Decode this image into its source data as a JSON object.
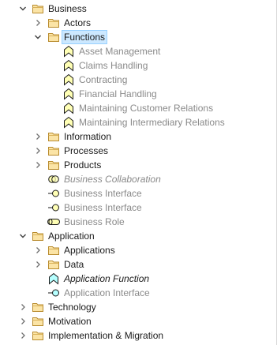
{
  "tree": {
    "business": {
      "label": "Business",
      "actors": "Actors",
      "functions": {
        "label": "Functions",
        "children": [
          "Asset Management",
          "Claims Handling",
          "Contracting",
          "Financial Handling",
          "Maintaining Customer Relations",
          "Maintaining Intermediary Relations"
        ]
      },
      "information": "Information",
      "processes": "Processes",
      "products": "Products",
      "business_collaboration": "Business Collaboration",
      "business_interface_1": "Business Interface",
      "business_interface_2": "Business Interface",
      "business_role": "Business Role"
    },
    "application": {
      "label": "Application",
      "applications": "Applications",
      "data": "Data",
      "application_function": "Application Function",
      "application_interface": "Application Interface"
    },
    "technology": "Technology",
    "motivation": "Motivation",
    "implementation_migration": "Implementation & Migration"
  },
  "colors": {
    "folder_fill": "#fbe4a6",
    "folder_stroke": "#b88b2e",
    "business_element": "#ffffb5",
    "application_element": "#b5ffff",
    "selection_bg": "#cce8ff",
    "selection_border": "#99d1ff",
    "dim_text": "#8a8a8a"
  }
}
